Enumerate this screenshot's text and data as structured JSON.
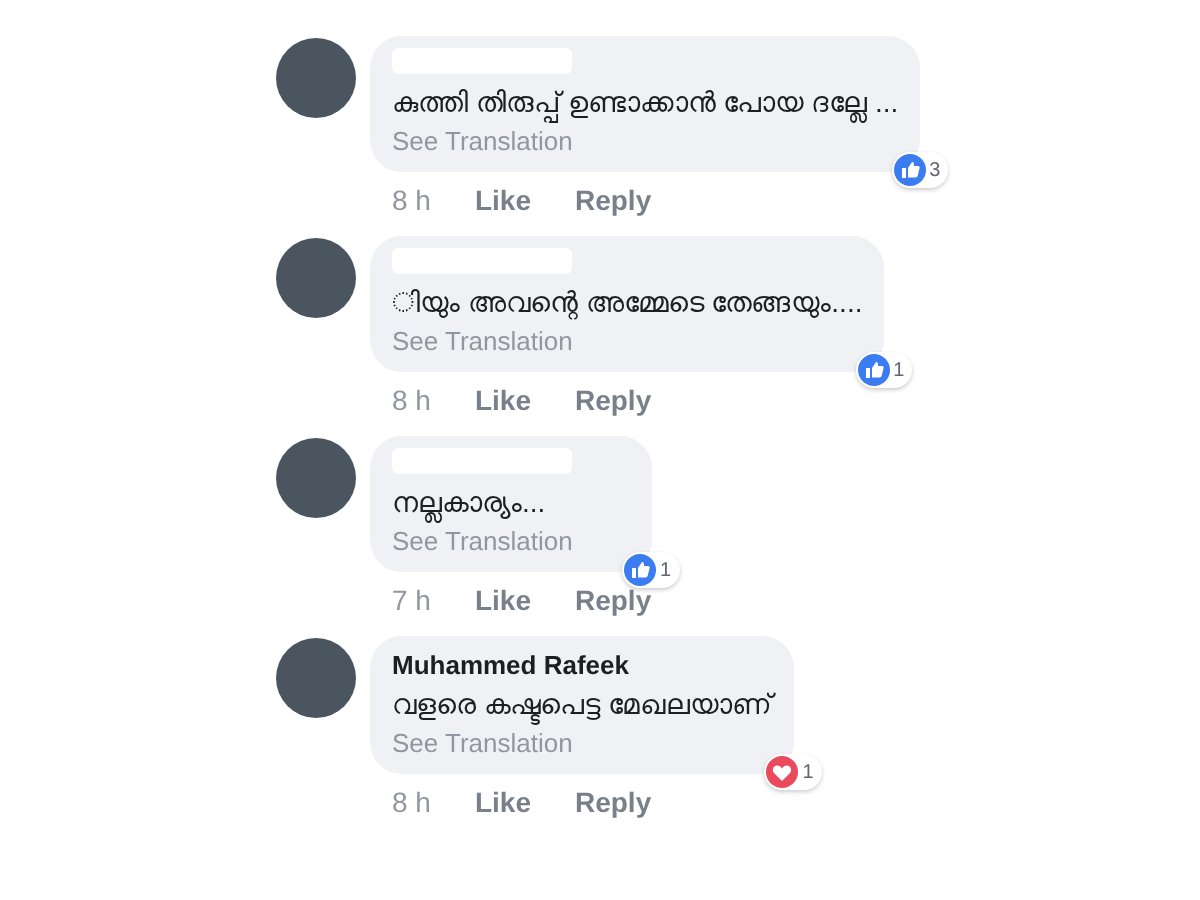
{
  "comments": [
    {
      "name_hidden": true,
      "text": "കുത്തി തിരുപ്പ് ഉണ്ടാക്കാൻ പോയ ദല്ലേ ...",
      "translate": "See Translation",
      "reaction": {
        "kind": "like",
        "count": "3"
      },
      "time": "8 h",
      "like": "Like",
      "reply": "Reply"
    },
    {
      "name_hidden": true,
      "text": "ിയും അവന്റെ അമ്മേടെ തേങ്ങയും....",
      "translate": "See Translation",
      "reaction": {
        "kind": "like",
        "count": "1"
      },
      "time": "8 h",
      "like": "Like",
      "reply": "Reply"
    },
    {
      "name_hidden": true,
      "text": "നല്ലകാര്യം...",
      "translate": "See Translation",
      "reaction": {
        "kind": "like",
        "count": "1"
      },
      "time": "7 h",
      "like": "Like",
      "reply": "Reply"
    },
    {
      "name_hidden": false,
      "name": "Muhammed Rafeek",
      "text": "വളരെ കഷ്ടപെട്ട മേഖലയാണ്",
      "translate": "See Translation",
      "reaction": {
        "kind": "love",
        "count": "1"
      },
      "time": "8 h",
      "like": "Like",
      "reply": "Reply"
    }
  ]
}
